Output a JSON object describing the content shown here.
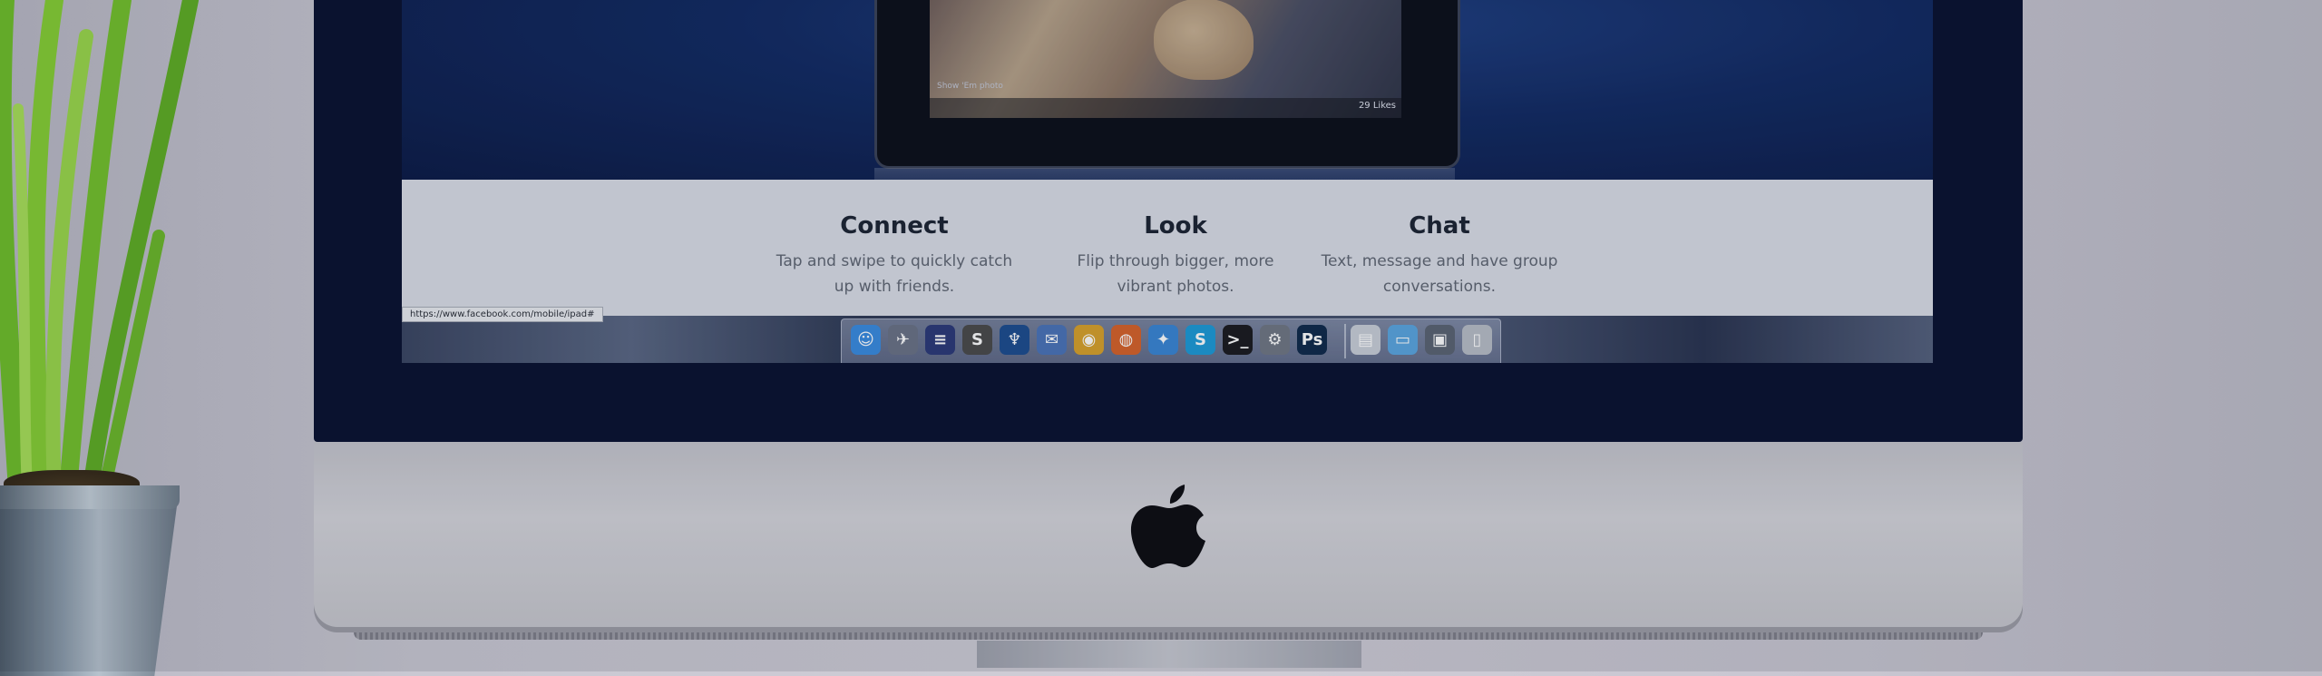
{
  "screen": {
    "status_url": "https://www.facebook.com/mobile/ipad#",
    "tablet_likes": "29 Likes",
    "tablet_caption": "Show 'Em photo",
    "features": [
      {
        "title": "Connect",
        "line1": "Tap and swipe to quickly catch",
        "line2": "up with friends."
      },
      {
        "title": "Look",
        "line1": "Flip through bigger, more",
        "line2": "vibrant photos."
      },
      {
        "title": "Chat",
        "line1": "Text, message and have group",
        "line2": "conversations."
      }
    ]
  },
  "dock": {
    "apps": [
      {
        "name": "finder-icon",
        "glyph": "☺",
        "color": "#3a8be0"
      },
      {
        "name": "launchpad-icon",
        "glyph": "✈",
        "color": "#6a7286"
      },
      {
        "name": "eclipse-icon",
        "glyph": "≡",
        "color": "#2c3a78"
      },
      {
        "name": "sublime-icon",
        "glyph": "S",
        "color": "#4b4b4b"
      },
      {
        "name": "sourcetree-icon",
        "glyph": "♆",
        "color": "#1d4d8f"
      },
      {
        "name": "thunderbird-icon",
        "glyph": "✉",
        "color": "#4a74b8"
      },
      {
        "name": "chrome-icon",
        "glyph": "◉",
        "color": "#d8a12b"
      },
      {
        "name": "firefox-icon",
        "glyph": "◍",
        "color": "#d7622a"
      },
      {
        "name": "safari-icon",
        "glyph": "✦",
        "color": "#3a86d4"
      },
      {
        "name": "skype-icon",
        "glyph": "S",
        "color": "#1d9ad6"
      },
      {
        "name": "terminal-icon",
        "glyph": ">_",
        "color": "#1b1b1f"
      },
      {
        "name": "system-preferences-icon",
        "glyph": "⚙",
        "color": "#707783"
      },
      {
        "name": "photoshop-icon",
        "glyph": "Ps",
        "color": "#0f2a4a"
      },
      {
        "name": "document-icon",
        "glyph": "▤",
        "color": "#c9cfd8"
      },
      {
        "name": "folder-icon",
        "glyph": "▭",
        "color": "#5aa6e0"
      },
      {
        "name": "screen-icon",
        "glyph": "▣",
        "color": "#5b6372"
      },
      {
        "name": "trash-icon",
        "glyph": "▯",
        "color": "#b8bdc6"
      }
    ]
  }
}
